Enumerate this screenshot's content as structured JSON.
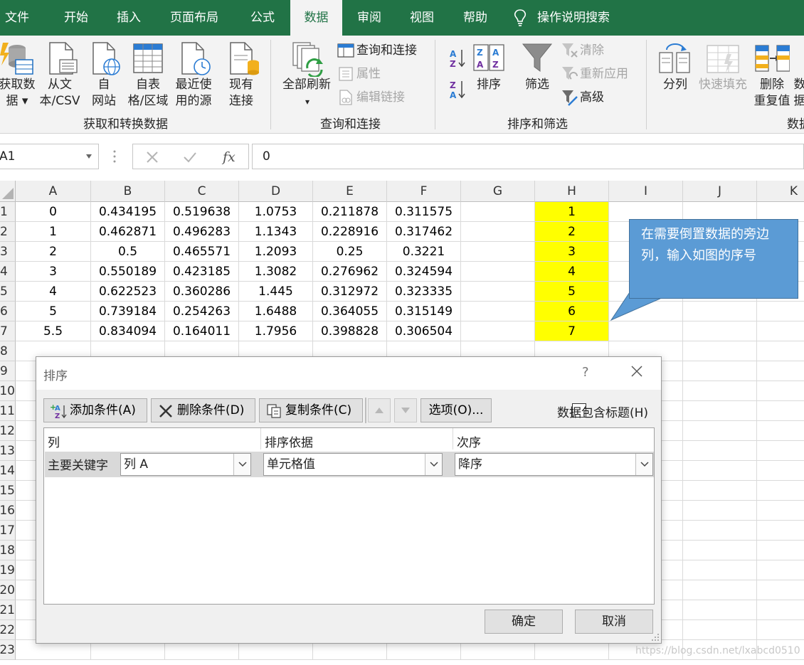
{
  "tabs": [
    "文件",
    "开始",
    "插入",
    "页面布局",
    "公式",
    "数据",
    "审阅",
    "视图",
    "帮助",
    "操作说明搜索"
  ],
  "active_tab": "数据",
  "ribbon": {
    "get_data": "获取数\n据 ▾",
    "from_text": "从文\n本/CSV",
    "from_web": "自\n网站",
    "from_table": "自表\n格/区域",
    "recent_sources": "最近使\n用的源",
    "existing_conn": "现有\n连接",
    "group1": "获取和转换数据",
    "refresh_all": "全部刷新",
    "refresh_arrow": "▾",
    "queries_conn": "查询和连接",
    "properties": "属性",
    "edit_links": "编辑链接",
    "group2": "查询和连接",
    "sort": "排序",
    "filter": "筛选",
    "clear": "清除",
    "reapply": "重新应用",
    "advanced": "高级",
    "group3": "排序和筛选",
    "text_to_col": "分列",
    "flash_fill": "快速填充",
    "remove_dup": "删除\n重复值",
    "data_cut": "数\n据",
    "group4": "数据"
  },
  "formula_bar": {
    "name_box": "A1",
    "formula": "0"
  },
  "columns": [
    "A",
    "B",
    "C",
    "D",
    "E",
    "F",
    "G",
    "H",
    "I",
    "J",
    "K"
  ],
  "rows": [
    "1",
    "2",
    "3",
    "4",
    "5",
    "6",
    "7",
    "8",
    "9",
    "10",
    "11",
    "12",
    "13",
    "14",
    "15",
    "16",
    "17",
    "18",
    "19",
    "20",
    "21",
    "22",
    "23"
  ],
  "cells": [
    [
      "0",
      "0.434195",
      "0.519638",
      "1.0753",
      "0.211878",
      "0.311575",
      "",
      "1"
    ],
    [
      "1",
      "0.462871",
      "0.496283",
      "1.1343",
      "0.228916",
      "0.317462",
      "",
      "2"
    ],
    [
      "2",
      "0.5",
      "0.465571",
      "1.2093",
      "0.25",
      "0.3221",
      "",
      "3"
    ],
    [
      "3",
      "0.550189",
      "0.423185",
      "1.3082",
      "0.276962",
      "0.324594",
      "",
      "4"
    ],
    [
      "4",
      "0.622523",
      "0.360286",
      "1.445",
      "0.312972",
      "0.323335",
      "",
      "5"
    ],
    [
      "5",
      "0.739184",
      "0.254263",
      "1.6488",
      "0.364055",
      "0.315149",
      "",
      "6"
    ],
    [
      "5.5",
      "0.834094",
      "0.164011",
      "1.7956",
      "0.398828",
      "0.306504",
      "",
      "7"
    ]
  ],
  "highlight_color": "#ffff00",
  "callout": "在需要倒置数据的旁边列，输入如图的序号",
  "dialog": {
    "title": "排序",
    "help": "?",
    "add_condition": "添加条件(A)",
    "delete_condition": "删除条件(D)",
    "copy_condition": "复制条件(C)",
    "options": "选项(O)...",
    "has_header": "数据包含标题(H)",
    "col_header": "列",
    "sort_on_header": "排序依据",
    "order_header": "次序",
    "primary_key": "主要关键字",
    "column_value": "列 A",
    "sort_on_value": "单元格值",
    "order_value": "降序",
    "ok": "确定",
    "cancel": "取消"
  },
  "watermark": "https://blog.csdn.net/lxabcd0510"
}
